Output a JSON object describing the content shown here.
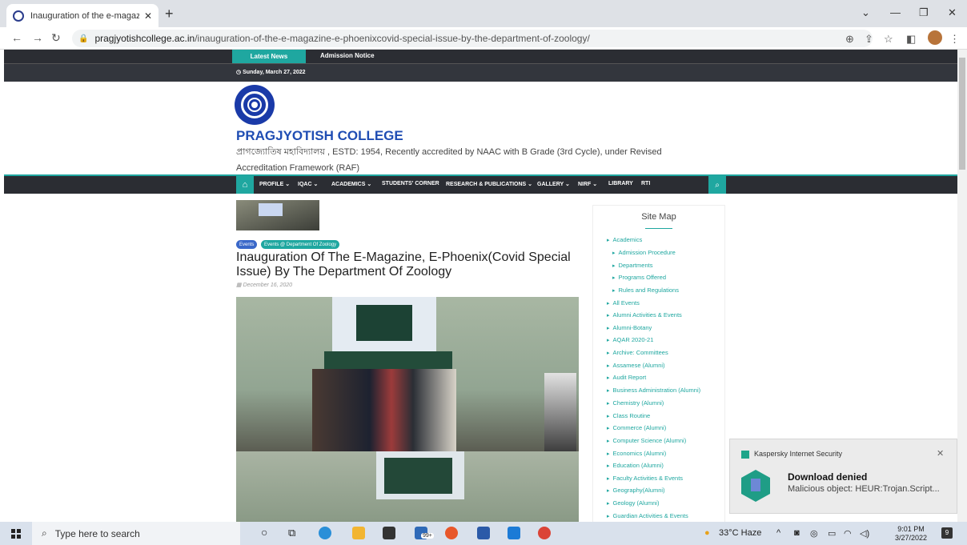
{
  "browser": {
    "tab_title": "Inauguration of the e-magazine",
    "tab_close": "✕",
    "new_tab": "+",
    "url_domain": "pragjyotishcollege.ac.in",
    "url_path": "/inauguration-of-the-e-magazine-e-phoenixcovid-special-issue-by-the-department-of-zoology/"
  },
  "topbar": {
    "latest_news": "Latest News",
    "admission_notice": "Admission Notice",
    "date": "Sunday, March 27, 2022"
  },
  "header": {
    "college_name": "PRAGJYOTISH COLLEGE",
    "tagline": "প্ৰাগজ্যোতিষ মহাবিদ্যালয় , ESTD: 1954, Recently accredited by NAAC with B Grade (3rd Cycle), under Revised Accreditation Framework (RAF)"
  },
  "nav": {
    "items": [
      "PROFILE ⌄",
      "IQAC ⌄",
      "ACADEMICS ⌄",
      "STUDENTS' CORNER",
      "RESEARCH & PUBLICATIONS ⌄",
      "GALLERY ⌄",
      "NIRF ⌄",
      "LIBRARY",
      "RTI"
    ]
  },
  "post": {
    "category_1": "Events",
    "category_2": "Events @ Department Of Zoology",
    "title": "Inauguration Of The E-Magazine, E-Phoenix(Covid Special Issue) By The Department Of Zoology",
    "date": "December 16, 2020"
  },
  "sitemap": {
    "title": "Site Map",
    "items": [
      "Academics",
      "Admission Procedure",
      "Departments",
      "Programs Offered",
      "Rules and Regulations",
      "All Events",
      "Alumni Activities & Events",
      "Alumni-Botany",
      "AQAR 2020-21",
      "Archive: Committees",
      "Assamese (Alumni)",
      "Audit Report",
      "Business Administration (Alumni)",
      "Chemistry (Alumni)",
      "Class Routine",
      "Commerce (Alumni)",
      "Computer Science (Alumni)",
      "Economics (Alumni)",
      "Education (Alumni)",
      "Faculty Activities & Events",
      "Geography(Alumni)",
      "Geology (Alumni)",
      "Guardian Activities & Events"
    ]
  },
  "notification": {
    "app": "Kaspersky Internet Security",
    "close": "✕",
    "title": "Download denied",
    "message": "Malicious object: HEUR:Trojan.Script..."
  },
  "taskbar": {
    "search_placeholder": "Type here to search",
    "mail_badge": "99+",
    "weather": "33°C Haze",
    "time": "9:01 PM",
    "date": "3/27/2022",
    "notifications": "9"
  },
  "colors": {
    "accent": "#1fa7a0",
    "dark_bar": "#2b2d33",
    "college_blue": "#1f4db3",
    "event_badge": "#3a68c9"
  }
}
